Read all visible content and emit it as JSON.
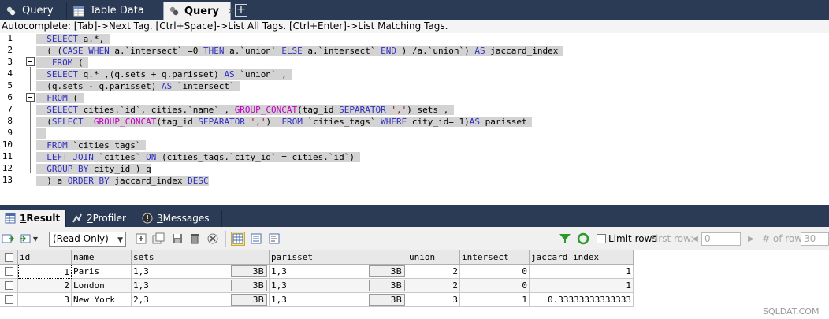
{
  "tabs": [
    {
      "label": "Query",
      "icon": "query-icon",
      "active": false
    },
    {
      "label": "Table Data",
      "icon": "table-icon",
      "active": false
    },
    {
      "label": "Query",
      "icon": "query-icon",
      "active": true,
      "close": "×"
    }
  ],
  "new_tab": "+",
  "autocomplete_hint": "Autocomplete: [Tab]->Next Tag. [Ctrl+Space]->List All Tags. [Ctrl+Enter]->List Matching Tags.",
  "editor": {
    "line_numbers": [
      "1",
      "2",
      "3",
      "4",
      "5",
      "6",
      "7",
      "8",
      "9",
      "10",
      "11",
      "12",
      "13"
    ]
  },
  "results": {
    "tabs": [
      {
        "num": "1",
        "label": " Result",
        "icon": "result-grid-icon"
      },
      {
        "num": "2",
        "label": " Profiler",
        "icon": "profiler-icon"
      },
      {
        "num": "3",
        "label": " Messages",
        "icon": "messages-icon"
      }
    ],
    "mode": "(Read Only)",
    "limit_rows": "Limit rows",
    "first_row_label": "First row:",
    "first_row_value": "0",
    "num_rows_label": "# of rows:",
    "num_rows_value": "30"
  },
  "grid": {
    "columns": [
      "id",
      "name",
      "sets",
      "parisset",
      "union",
      "intersect",
      "jaccard_index"
    ],
    "rows": [
      {
        "id": "1",
        "name": "Paris",
        "sets": "1,3",
        "sets_size": "3B",
        "parisset": "1,3",
        "parisset_size": "3B",
        "union": "2",
        "intersect": "0",
        "jaccard_index": "1"
      },
      {
        "id": "2",
        "name": "London",
        "sets": "1,3",
        "sets_size": "3B",
        "parisset": "1,3",
        "parisset_size": "3B",
        "union": "2",
        "intersect": "0",
        "jaccard_index": "1"
      },
      {
        "id": "3",
        "name": "New York",
        "sets": "2,3",
        "sets_size": "3B",
        "parisset": "1,3",
        "parisset_size": "3B",
        "union": "3",
        "intersect": "1",
        "jaccard_index": "0.33333333333333"
      }
    ]
  },
  "watermark": "SQLDAT.COM",
  "colors": {
    "tabbar": "#2b3a55",
    "keyword": "#3030c0",
    "function": "#c000c0",
    "string": "#a00000",
    "highlight": "#d3d3d3"
  }
}
